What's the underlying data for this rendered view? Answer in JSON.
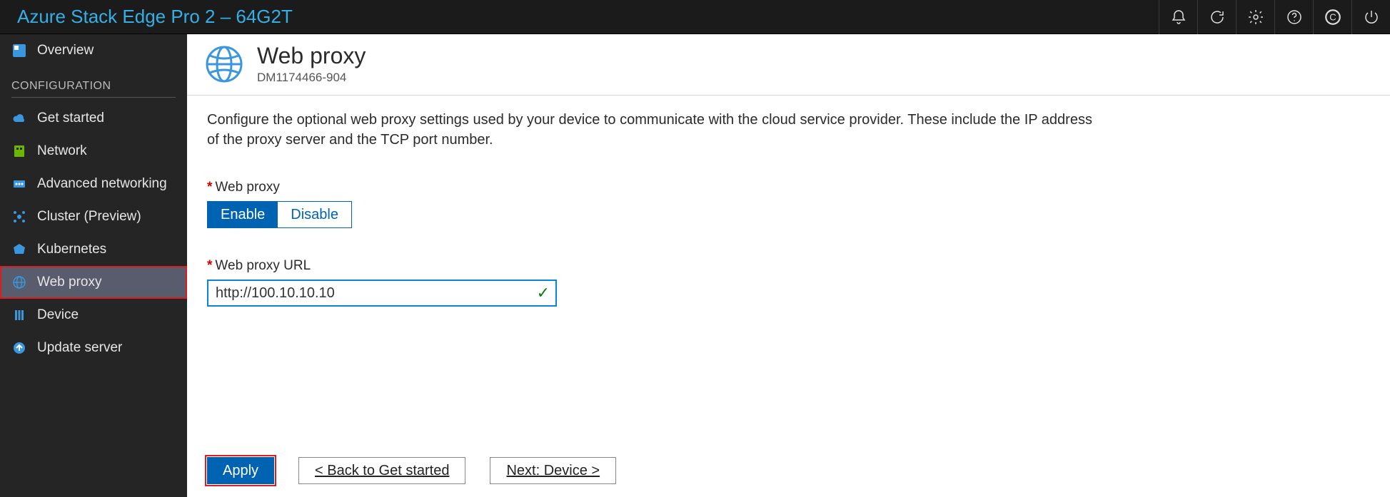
{
  "header": {
    "title": "Azure Stack Edge Pro 2 – 64G2T"
  },
  "sidebar": {
    "overview": "Overview",
    "section": "CONFIGURATION",
    "items": {
      "get_started": "Get started",
      "network": "Network",
      "adv_networking": "Advanced networking",
      "cluster": "Cluster (Preview)",
      "kubernetes": "Kubernetes",
      "web_proxy": "Web proxy",
      "device": "Device",
      "update_server": "Update server"
    }
  },
  "page": {
    "title": "Web proxy",
    "subtitle": "DM1174466-904",
    "description": "Configure the optional web proxy settings used by your device to communicate with the cloud service provider. These include the IP address of the proxy server and the TCP port number.",
    "fields": {
      "web_proxy_label": "Web proxy",
      "enable": "Enable",
      "disable": "Disable",
      "url_label": "Web proxy URL",
      "url_value": "http://100.10.10.10"
    },
    "buttons": {
      "apply": "Apply",
      "back": "<  Back to Get started",
      "next": "Next: Device  >"
    }
  }
}
